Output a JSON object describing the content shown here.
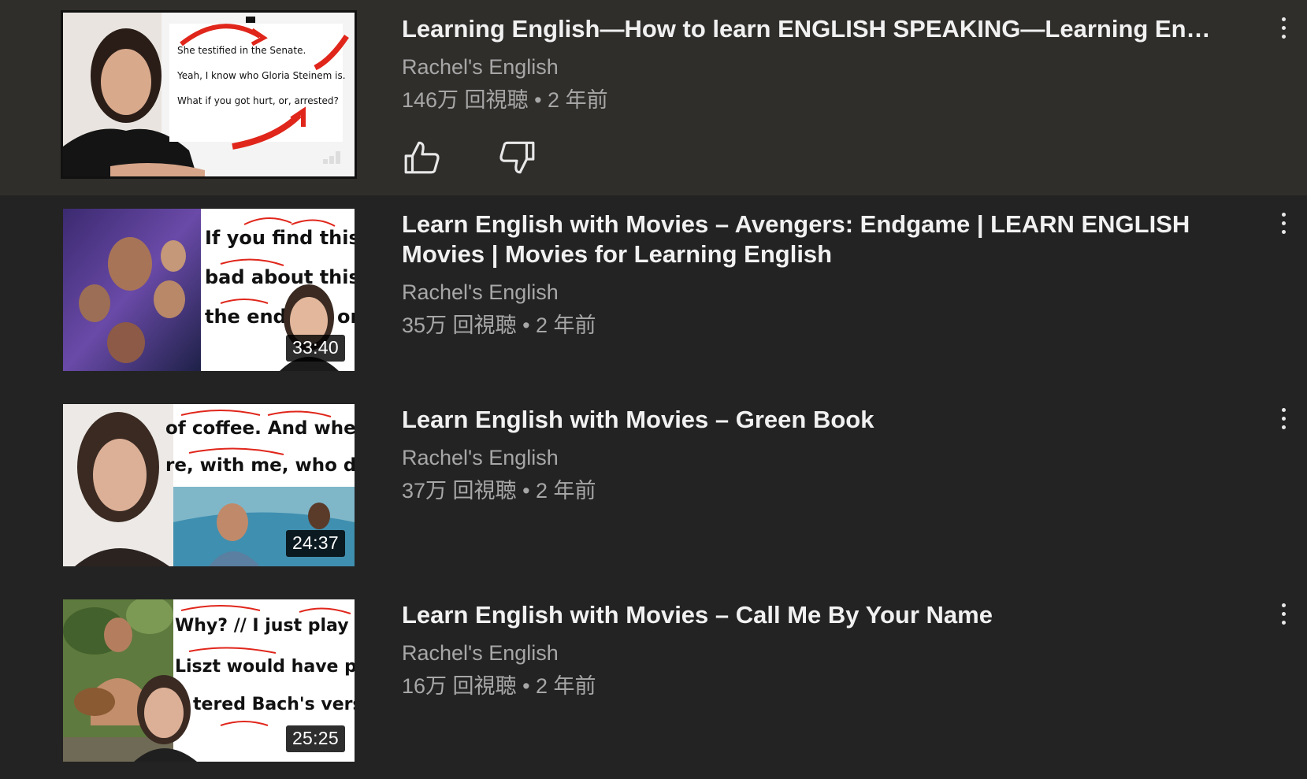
{
  "videos": [
    {
      "title": "Learning English—How to learn ENGLISH SPEAKING—Learning English…",
      "channel": "Rachel's English",
      "views": "146万 回視聴",
      "age": "2 年前",
      "duration": "",
      "thumb_text": [
        "She testified in the Senate.",
        "Yeah, I know who Gloria Steinem is.",
        "What if you got hurt, or, arrested?"
      ]
    },
    {
      "title": "Learn English with Movies – Avengers: Endgame | LEARN ENGLISH Movies | Movies for Learning English",
      "channel": "Rachel's English",
      "views": "35万 回視聴",
      "age": "2 年前",
      "duration": "33:40",
      "thumb_text": [
        "If you find this re",
        "bad about this. F",
        "the end.",
        "or"
      ]
    },
    {
      "title": "Learn English with Movies – Green Book",
      "channel": "Rachel's English",
      "views": "37万 回視聴",
      "age": "2 年前",
      "duration": "24:37",
      "thumb_text": [
        "of coffee. And where",
        "re, with me, who did"
      ]
    },
    {
      "title": "Learn English with Movies – Call Me By Your Name",
      "channel": "Rachel's English",
      "views": "16万 回視聴",
      "age": "2 年前",
      "duration": "25:25",
      "thumb_text": [
        "Why? // I just play",
        "Liszt would have pl",
        "tered Bach's versi"
      ]
    }
  ],
  "meta_separator": "•",
  "icons": {
    "like": "thumb-up-icon",
    "dislike": "thumb-down-icon",
    "menu": "more-vert-icon"
  },
  "colors": {
    "background": "#232323",
    "selected_row": "#302e2b",
    "title": "#f1f1f1",
    "secondary_text": "#a7a7a7",
    "annotation_red": "#e0261b"
  }
}
